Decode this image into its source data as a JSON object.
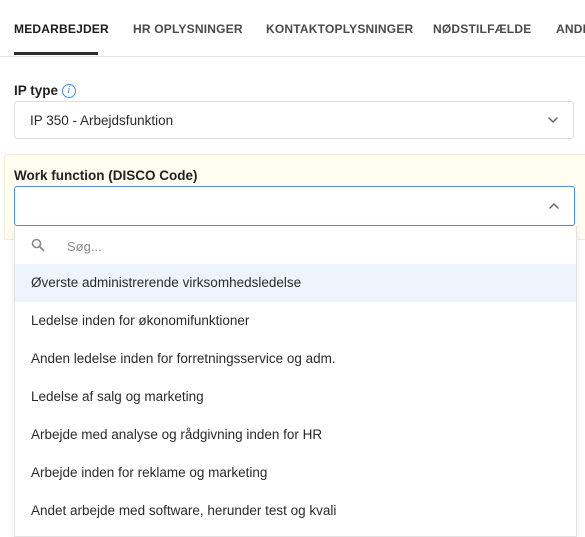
{
  "tabs": [
    {
      "label": "MEDARBEJDER",
      "active": true
    },
    {
      "label": "HR OPLYSNINGER",
      "active": false
    },
    {
      "label": "KONTAKTOPLYSNINGER",
      "active": false
    },
    {
      "label": "NØDSTILFÆLDE",
      "active": false
    },
    {
      "label": "ANDE",
      "active": false
    }
  ],
  "ip_type": {
    "label": "IP type",
    "info_icon": "info-icon",
    "info_glyph": "i",
    "value": "IP 350 - Arbejdsfunktion"
  },
  "work_function": {
    "label": "Work function (DISCO Code)",
    "value": "",
    "search_placeholder": "Søg...",
    "options": [
      "Øverste administrerende virksomhedsledelse",
      "Ledelse inden for økonomifunktioner",
      "Anden ledelse inden for forretningsservice og adm.",
      "Ledelse af salg og marketing",
      "Arbejde med analyse og rådgivning inden for HR",
      "Arbejde inden for reklame og marketing",
      "Andet arbejde med software, herunder test og kvali"
    ],
    "highlighted_index": 0
  },
  "colors": {
    "accent": "#4a90e2",
    "fab_blue": "#3b82e4",
    "fab_green": "#5cb946",
    "highlight": "#eef4fb",
    "panel_yellow": "#fffdf0"
  }
}
